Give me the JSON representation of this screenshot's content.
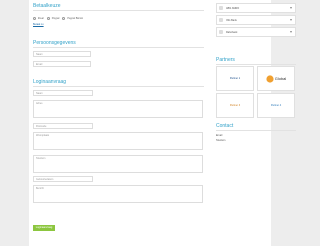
{
  "payment": {
    "title": "Betaalkeuze",
    "options": [
      "iDeal",
      "Paypal",
      "Paypal Bitcoin"
    ],
    "link": "Betaal nu"
  },
  "personal": {
    "title": "Persoonsgegevens",
    "name_placeholder": "Naam",
    "email_placeholder": "Email"
  },
  "request": {
    "title": "Loginaanvraag",
    "fields": [
      "Naam",
      "Adres",
      "Postcode",
      "Woonplaats",
      "Telefoon",
      "Geboortedatum",
      "Bericht"
    ],
    "submit": "Loginaanvraag verzenden"
  },
  "sidebar": {
    "banks": [
      "ABN AMRO",
      "ING Bank",
      "Rabobank"
    ],
    "partners_title": "Partners",
    "logos": [
      "Partner 1",
      "Global",
      "Partner 3",
      "Partner 4"
    ],
    "contact_title": "Contact",
    "contact_lines": [
      "Email",
      "Telefoon"
    ]
  },
  "colors": {
    "accent": "#33a2c9",
    "button": "#8cc63f",
    "link": "#1a6aa5"
  }
}
